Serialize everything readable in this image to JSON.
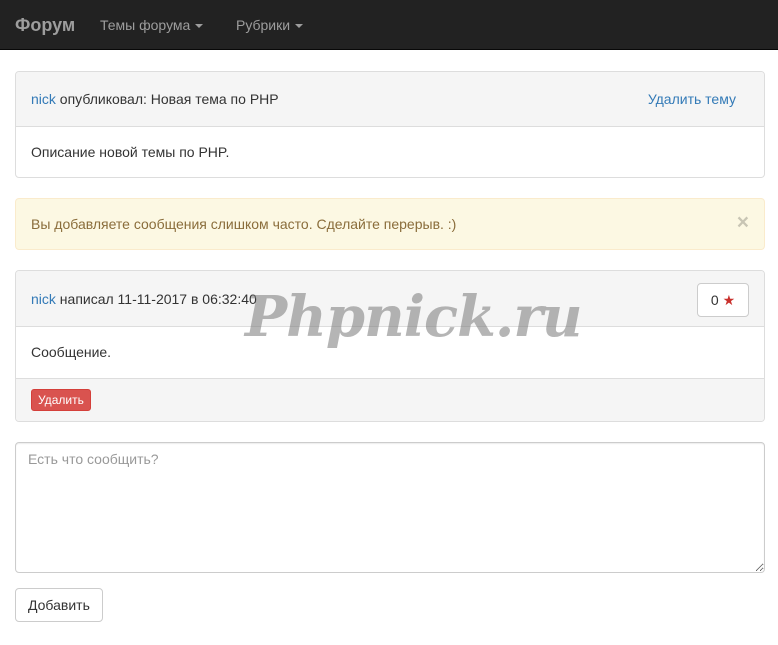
{
  "navbar": {
    "brand": "Форум",
    "items": [
      {
        "label": "Темы форума"
      },
      {
        "label": "Рубрики"
      }
    ]
  },
  "topic": {
    "author": "nick",
    "published_text": " опубликовал: Новая тема по PHP",
    "delete_label": "Удалить тему",
    "description": "Описание новой темы по PHP."
  },
  "alert": {
    "message": "Вы добавляете сообщения слишком часто. Сделайте перерыв. :)",
    "close_label": "×"
  },
  "post": {
    "author": "nick",
    "written_text": " написал 11-11-2017 в 06:32:40",
    "rating": "0",
    "star": "★",
    "body": "Сообщение.",
    "delete_label": "Удалить"
  },
  "reply": {
    "placeholder": "Есть что сообщить?",
    "submit_label": "Добавить"
  },
  "watermark": "Phpnick.ru",
  "colors": {
    "navbar": "#222222",
    "link": "#337ab7",
    "alert_bg": "#fcf8e3",
    "alert_text": "#8a6d3b",
    "danger": "#d9534f"
  }
}
